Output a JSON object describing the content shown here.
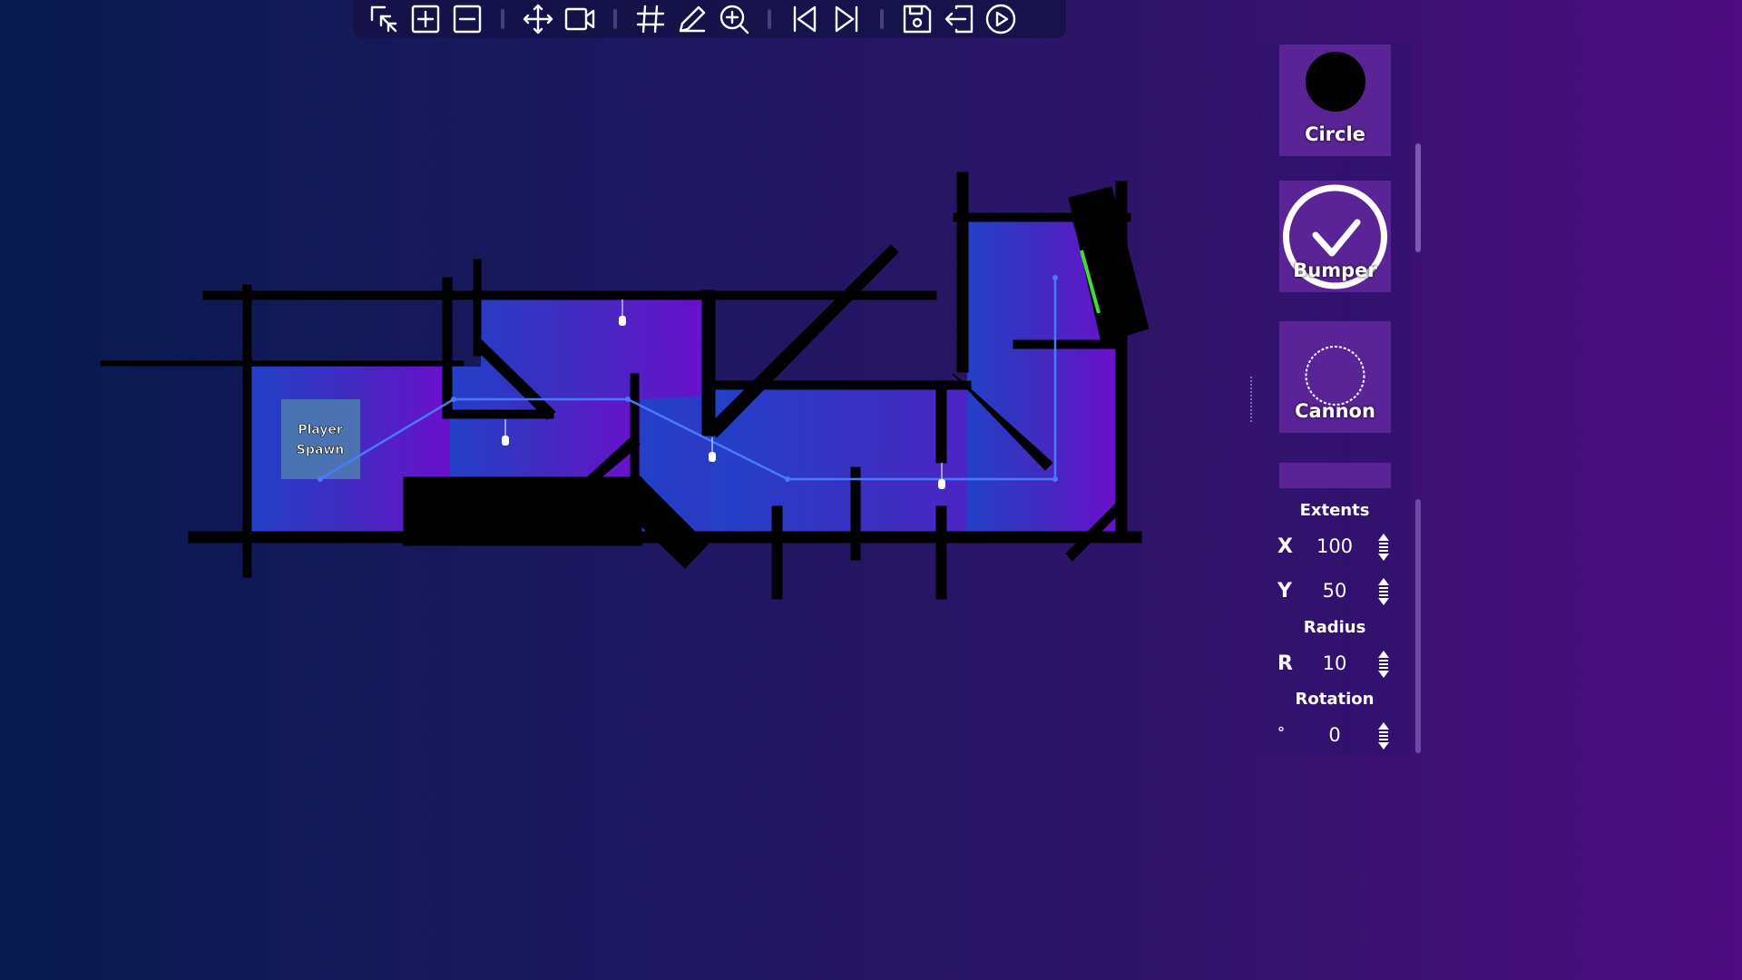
{
  "toolbar": {
    "buttons": [
      {
        "id": "select",
        "icon": "select-icon"
      },
      {
        "id": "add",
        "icon": "plus-square-icon"
      },
      {
        "id": "remove",
        "icon": "minus-square-icon"
      },
      {
        "id": "move",
        "icon": "move-icon"
      },
      {
        "id": "camera",
        "icon": "camera-icon"
      },
      {
        "id": "grid",
        "icon": "grid-icon"
      },
      {
        "id": "draw",
        "icon": "pencil-icon"
      },
      {
        "id": "zoom",
        "icon": "zoom-in-icon"
      },
      {
        "id": "prev",
        "icon": "skip-back-icon"
      },
      {
        "id": "next",
        "icon": "skip-forward-icon"
      },
      {
        "id": "save",
        "icon": "save-icon"
      },
      {
        "id": "exit",
        "icon": "exit-icon"
      },
      {
        "id": "play",
        "icon": "play-icon"
      }
    ]
  },
  "level": {
    "spawn_label_line1": "Player",
    "spawn_label_line2": "Spawn"
  },
  "panel": {
    "tiles": [
      {
        "label": "Circle",
        "icon": "circle-icon"
      },
      {
        "label": "Bumper",
        "icon": "checkmark-circle-icon"
      },
      {
        "label": "Cannon",
        "icon": "dotted-circle-icon"
      }
    ],
    "extents_heading": "Extents",
    "x_key": "X",
    "x_value": "100",
    "y_key": "Y",
    "y_value": "50",
    "radius_heading": "Radius",
    "r_key": "R",
    "r_value": "10",
    "rotation_heading": "Rotation",
    "rot_key": "°",
    "rot_value": "0"
  },
  "colors": {
    "background_start": "#071a4e",
    "background_end": "#4d0c80",
    "path_line": "#4a78ff",
    "bumper_green": "#3fdc3a",
    "tile_bg": "#5a2496"
  }
}
